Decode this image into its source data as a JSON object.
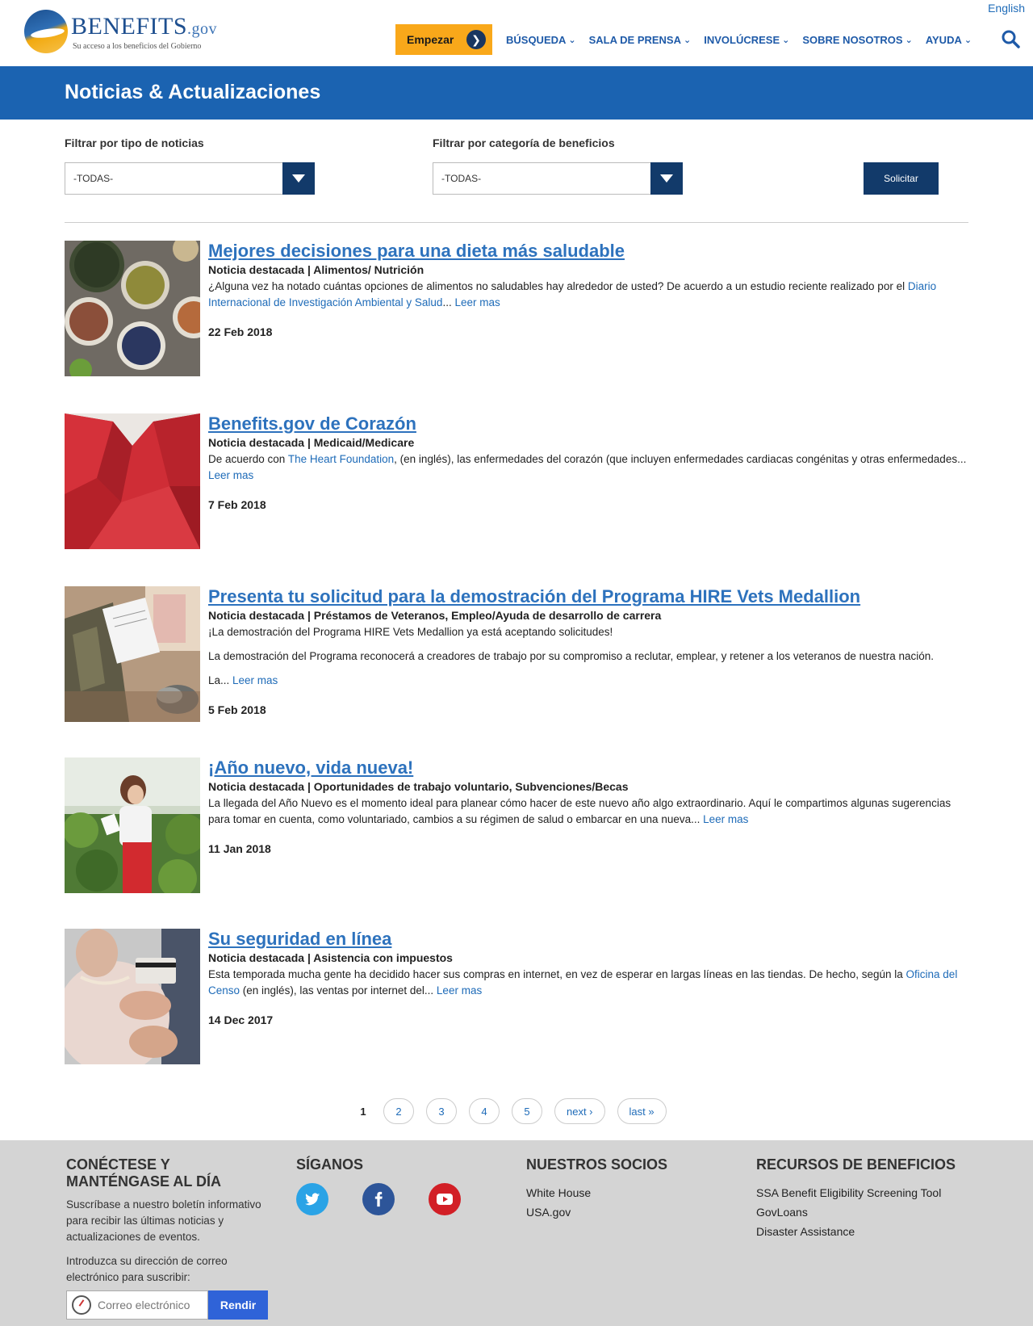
{
  "header": {
    "logo_main": "BENEFITS",
    "logo_suffix": ".gov",
    "logo_tagline": "Su acceso a los beneficios del Gobierno",
    "language_link": "English",
    "start_button": "Empezar",
    "nav": [
      "BÚSQUEDA",
      "SALA DE PRENSA",
      "INVOLÚCRESE",
      "SOBRE NOSOTROS",
      "AYUDA"
    ]
  },
  "banner": {
    "title": "Noticias & Actualizaciones"
  },
  "filters": {
    "type_label": "Filtrar por tipo de noticias",
    "type_value": "-TODAS-",
    "category_label": "Filtrar por categoría de beneficios",
    "category_value": "-TODAS-",
    "apply_button": "Solicitar"
  },
  "articles": [
    {
      "title": "Mejores decisiones para una dieta más saludable",
      "meta": "Noticia destacada | Alimentos/ Nutrición",
      "desc_before": "¿Alguna vez ha notado cuántas opciones de alimentos no saludables hay alrededor de usted? De acuerdo a un estudio reciente realizado por el ",
      "desc_link": "Diario Internacional de Investigación Ambiental y Salud",
      "desc_after": "... ",
      "read_more": "Leer mas",
      "date": "22 Feb 2018",
      "image": "spices-bowls"
    },
    {
      "title": "Benefits.gov de Corazón",
      "meta": "Noticia destacada | Medicaid/Medicare",
      "desc_before": "De acuerdo con ",
      "desc_link": "The Heart Foundation",
      "desc_after": ", (en inglés), las enfermedades del corazón (que incluyen enfermedades cardiacas congénitas y otras enfermedades... ",
      "read_more": "Leer mas",
      "date": "7 Feb 2018",
      "image": "paper-heart"
    },
    {
      "title": "Presenta tu solicitud para la demostración del Programa HIRE Vets Medallion",
      "meta": "Noticia destacada | Préstamos de Veteranos, Empleo/Ayuda de desarrollo de carrera",
      "para1": "¡La demostración del Programa HIRE Vets Medallion ya está aceptando solicitudes!",
      "para2": "La demostración del Programa reconocerá a creadores de trabajo por su compromiso a reclutar, emplear, y retener a los veteranos de nuestra nación.",
      "para3": "La... ",
      "read_more": "Leer mas",
      "date": "5 Feb 2018",
      "image": "veteran-clipboard"
    },
    {
      "title": "¡Año nuevo, vida nueva!",
      "meta": "Noticia destacada | Oportunidades de trabajo voluntario, Subvenciones/Becas",
      "desc_before": "La llegada del Año Nuevo es el momento ideal para planear cómo hacer de este nuevo año algo extraordinario. Aquí le compartimos algunas sugerencias para tomar en cuenta, como voluntariado, cambios a su régimen de salud o embarcar en una nueva... ",
      "read_more": "Leer mas",
      "date": "11 Jan 2018",
      "image": "woman-plants"
    },
    {
      "title": "Su seguridad en línea",
      "meta": "Noticia destacada | Asistencia con impuestos",
      "desc_before": "Esta temporada mucha gente ha decidido hacer sus compras en internet, en vez de esperar en largas líneas en las tiendas. De hecho, según la ",
      "desc_link": "Oficina del Censo",
      "desc_after": " (en inglés), las ventas por internet del... ",
      "read_more": "Leer mas",
      "date": "14 Dec 2017",
      "image": "credit-card-phone"
    }
  ],
  "pagination": {
    "current": "1",
    "pages": [
      "2",
      "3",
      "4",
      "5"
    ],
    "next": "next ›",
    "last": "last »"
  },
  "footer": {
    "connect_title": "CONÉCTESE Y MANTÉNGASE AL DÍA",
    "connect_text": "Suscríbase a nuestro boletín informativo para recibir las últimas noticias y actualizaciones de eventos.",
    "email_prompt": "Introduzca su dirección de correo electrónico para suscribir:",
    "email_placeholder": "Correo electrónico",
    "submit_button": "Rendir",
    "follow_title": "SÍGANOS",
    "partners_title": "NUESTROS SOCIOS",
    "partners": [
      "White House",
      "USA.gov"
    ],
    "resources_title": "RECURSOS DE BENEFICIOS",
    "resources": [
      "SSA Benefit Eligibility Screening Tool",
      "GovLoans",
      "Disaster Assistance"
    ]
  },
  "colors": {
    "accent_blue": "#1b63b1",
    "start_orange": "#f9a81a",
    "dark_navy": "#123a6a",
    "footer_gray": "#d4d4d4"
  }
}
